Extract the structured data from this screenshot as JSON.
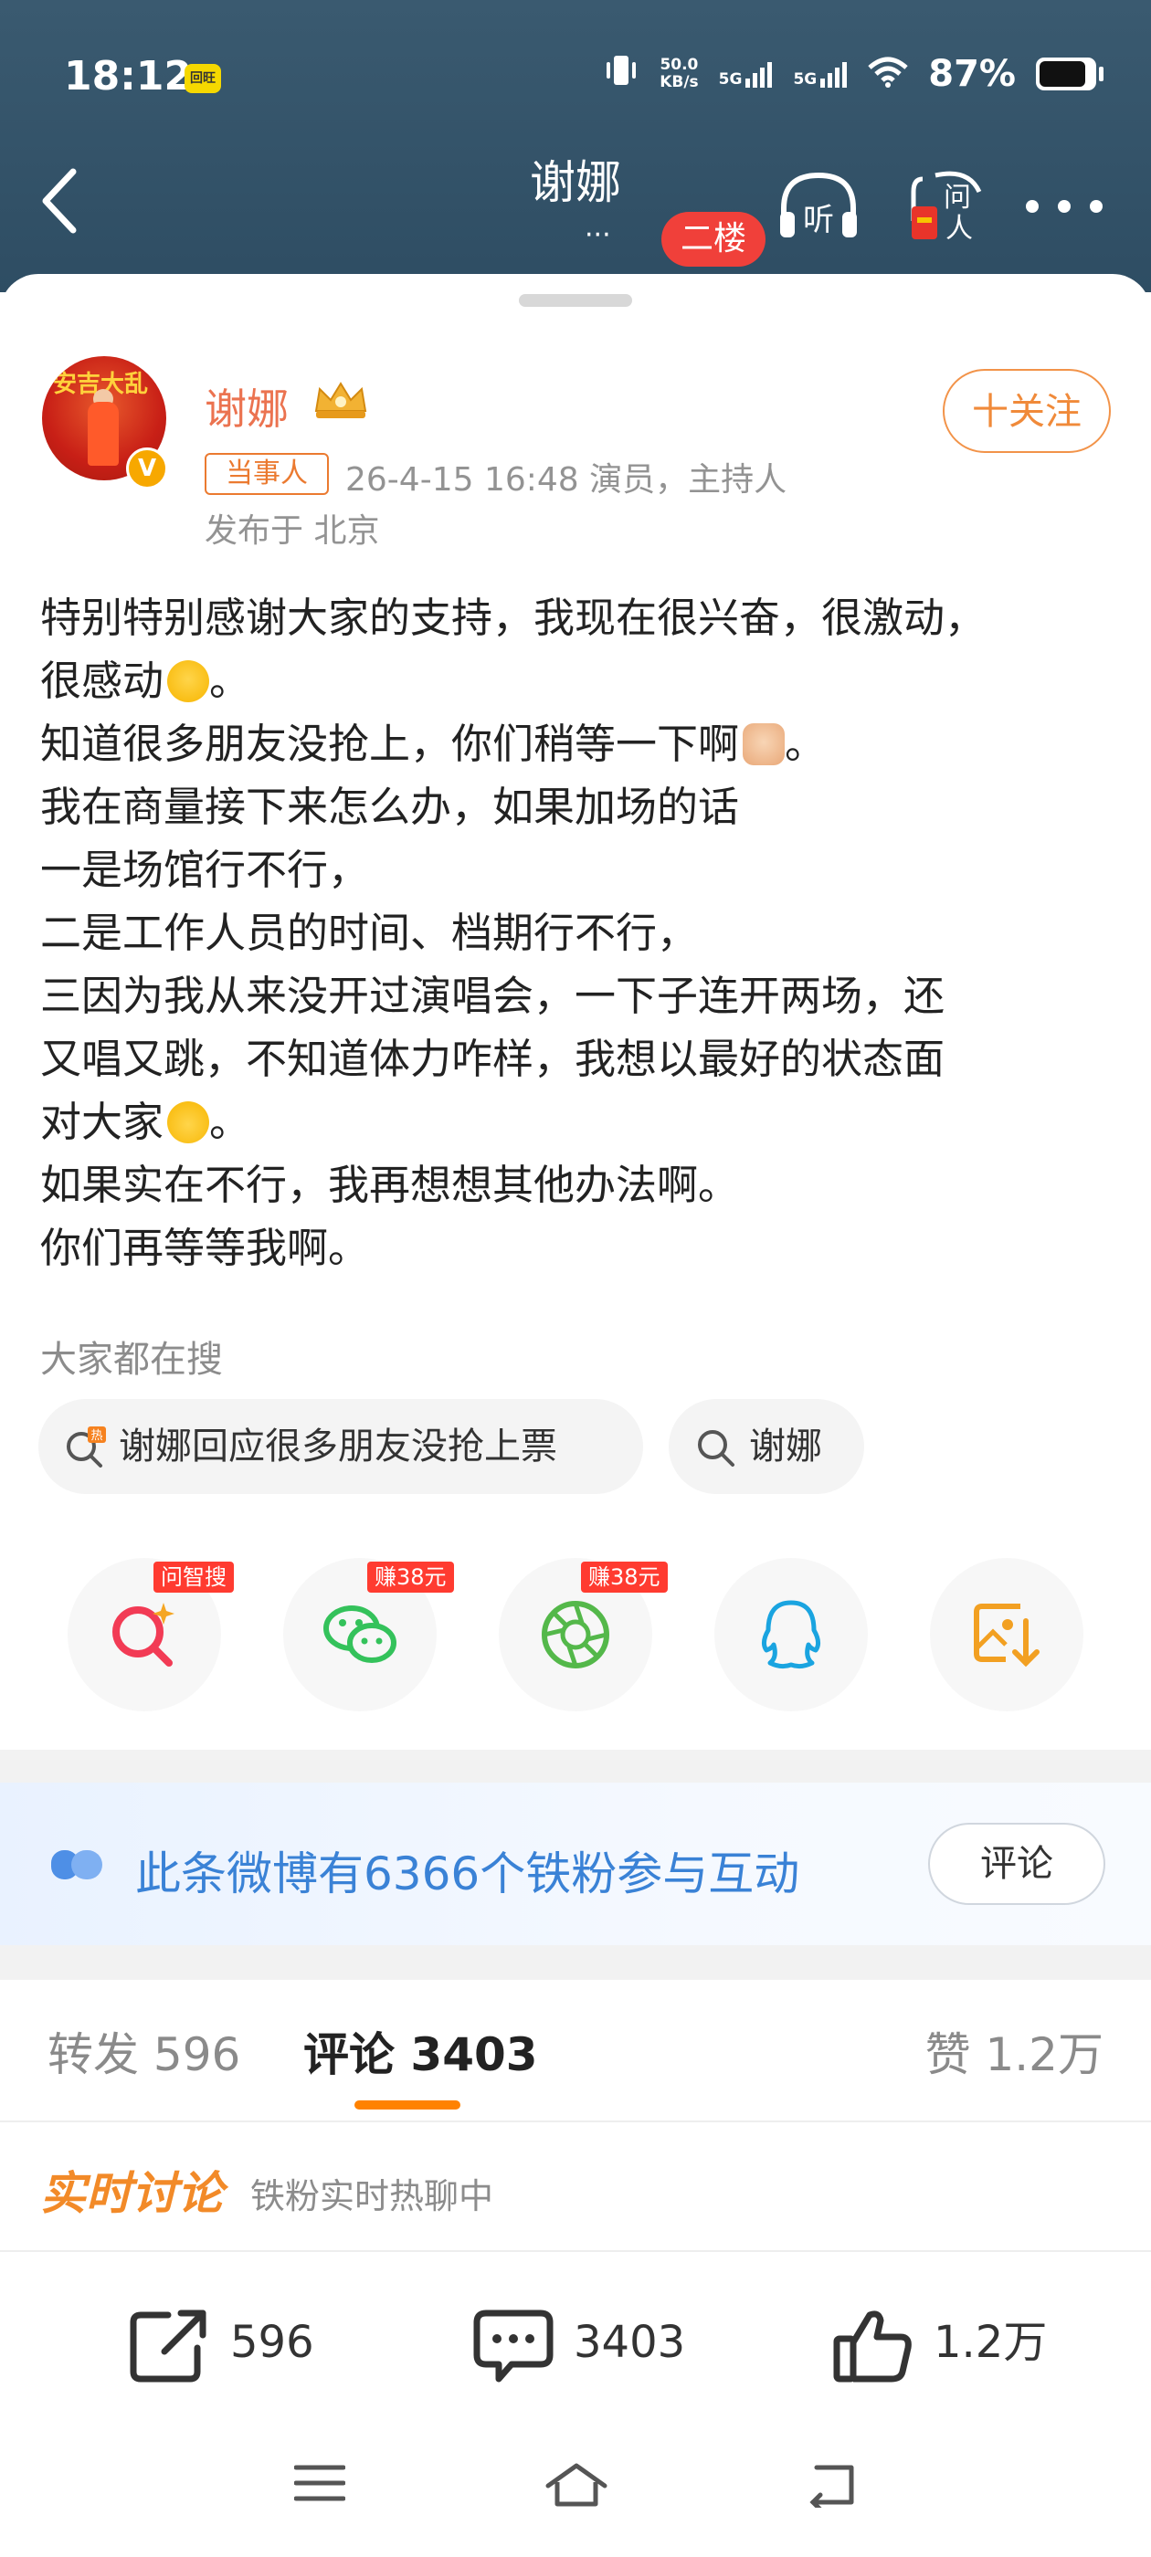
{
  "status_bar": {
    "time": "18:12",
    "badge_icon": "app-notification-icon",
    "badge_text": "回旺",
    "net_speed_top": "50.0",
    "net_speed_bottom": "KB/s",
    "sim1": "5G",
    "sim2": "5G",
    "battery_text": "87%",
    "battery_level": 0.87
  },
  "nav": {
    "title": "谢娜",
    "subtitle_dots": "···",
    "floor_badge": "二楼",
    "listen_label": "听",
    "ask_label": "问人"
  },
  "post": {
    "author": "谢娜",
    "party_tag": "当事人",
    "meta": "26-4-15 16:48   演员，主持人",
    "publish_place": "发布于 北京",
    "follow_button": "十关注",
    "avatar_text": "安吉大乱",
    "verified_mark": "V",
    "lines": [
      "特别特别感谢大家的支持，我现在很兴奋，很激动，",
      "很感动",
      "。",
      "知道很多朋友没抢上，你们稍等一下啊",
      "。",
      "我在商量接下来怎么办，如果加场的话",
      "一是场馆行不行，",
      "二是工作人员的时间、档期行不行，",
      "三因为我从来没开过演唱会，一下子连开两场，还",
      "又唱又跳，不知道体力咋样，我想以最好的状态面",
      "对大家",
      "。",
      "如果实在不行，我再想想其他办法啊。",
      "你们再等等我啊。"
    ]
  },
  "search": {
    "header": "大家都在搜",
    "chips": [
      {
        "label": "谢娜回应很多朋友没抢上票",
        "icon": "hot-search-icon"
      },
      {
        "label": "谢娜",
        "icon": "search-icon"
      }
    ]
  },
  "share": {
    "buttons": [
      {
        "name": "ai-search",
        "tag": "问智搜"
      },
      {
        "name": "wechat",
        "tag": "赚38元"
      },
      {
        "name": "moments",
        "tag": "赚38元"
      },
      {
        "name": "qq",
        "tag": ""
      },
      {
        "name": "save-image",
        "tag": ""
      }
    ]
  },
  "iron_fans": {
    "text": "此条微博有6366个铁粉参与互动",
    "button": "评论"
  },
  "tabs": {
    "repost": "转发 596",
    "comment": "评论 3403",
    "like": "赞 1.2万"
  },
  "live": {
    "title": "实时讨论",
    "subtitle": "铁粉实时热聊中"
  },
  "actions": {
    "repost": "596",
    "comment": "3403",
    "like": "1.2万"
  },
  "colors": {
    "header_bg": "#2e4d63",
    "accent_orange": "#eb7350",
    "link_blue": "#3a82d6",
    "badge_red": "#f0403a"
  }
}
